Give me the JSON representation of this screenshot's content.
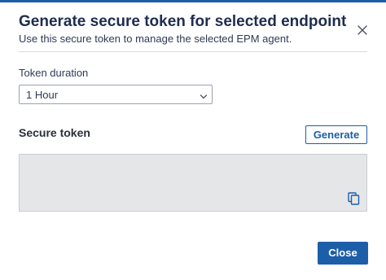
{
  "dialog": {
    "title": "Generate secure token for selected endpoint",
    "subtitle": "Use this secure token to manage the selected EPM agent.",
    "close_icon": "close-icon"
  },
  "duration": {
    "label": "Token duration",
    "selected": "1 Hour",
    "chevron_icon": "chevron-down-icon"
  },
  "token": {
    "section_title": "Secure token",
    "generate_label": "Generate",
    "value": "",
    "copy_icon": "copy-icon"
  },
  "footer": {
    "close_label": "Close"
  },
  "colors": {
    "accent": "#1d5ea8",
    "title": "#1f2d4d",
    "token_bg": "#e5e6e8"
  }
}
